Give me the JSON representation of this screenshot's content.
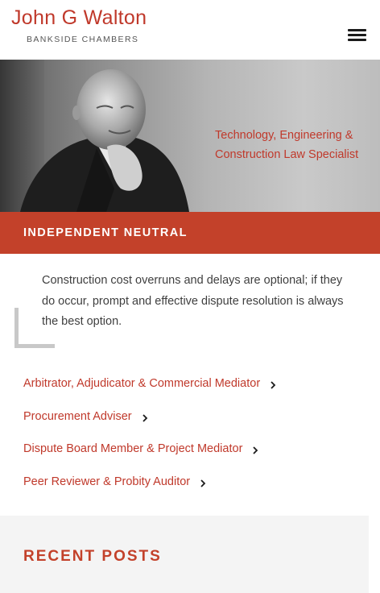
{
  "header": {
    "name": "John G Walton",
    "chambers": "BANKSIDE CHAMBERS",
    "menu_icon": "hamburger-menu-icon"
  },
  "hero": {
    "tagline_line1": "Technology, Engineering &",
    "tagline_line2": "Construction Law Specialist"
  },
  "banner": {
    "title": "INDEPENDENT NEUTRAL"
  },
  "quote": {
    "text": "Construction cost overruns and delays are optional; if they do occur, prompt and effective dispute resolution is always the best option."
  },
  "roles": [
    {
      "label": "Arbitrator, Adjudicator & Commercial Mediator",
      "icon": "chevron-right-icon"
    },
    {
      "label": "Procurement Adviser",
      "icon": "chevron-right-icon"
    },
    {
      "label": "Dispute Board Member & Project Mediator",
      "icon": "chevron-right-icon"
    },
    {
      "label": "Peer Reviewer & Probity Auditor",
      "icon": "chevron-right-icon"
    }
  ],
  "recent_posts": {
    "title": "RECENT POSTS"
  },
  "colors": {
    "accent": "#c0392b",
    "banner": "#c3412a",
    "text": "#3f3f3f",
    "section_bg": "#f4f4f4"
  }
}
